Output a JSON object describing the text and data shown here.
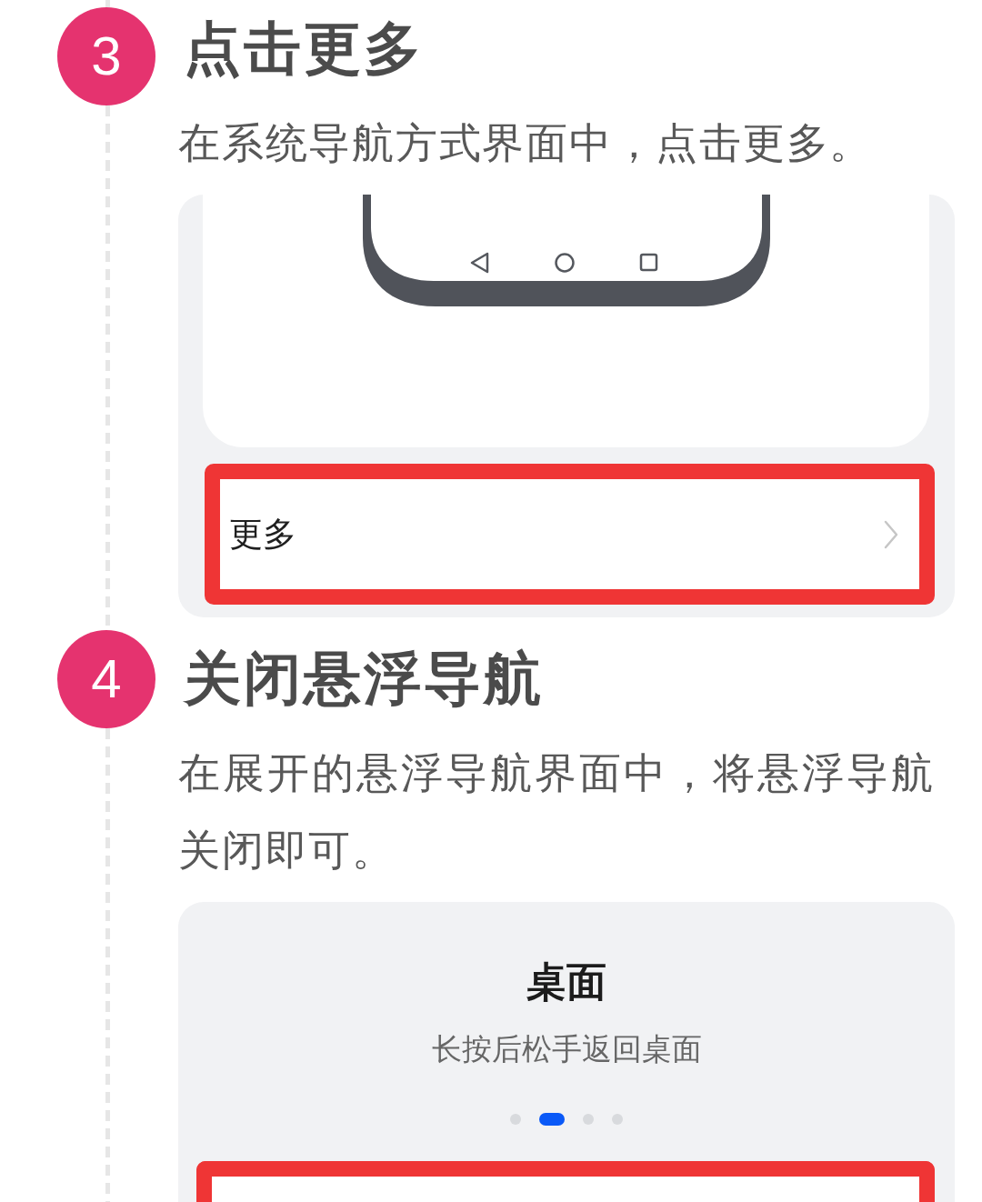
{
  "steps": [
    {
      "number": "3",
      "title": "点击更多",
      "description": "在系统导航方式界面中，点击更多。",
      "screenshot": {
        "kind": "nav_settings",
        "row": {
          "label": "更多",
          "highlighted": true
        }
      }
    },
    {
      "number": "4",
      "title": "关闭悬浮导航",
      "description": "在展开的悬浮导航界面中，将悬浮导航关闭即可。",
      "screenshot": {
        "kind": "floating_nav",
        "title": "桌面",
        "subtitle": "长按后松手返回桌面",
        "pages": [
          {
            "selected": false
          },
          {
            "selected": true
          },
          {
            "selected": false
          },
          {
            "selected": false
          }
        ],
        "row": {
          "highlighted": true
        }
      }
    }
  ]
}
